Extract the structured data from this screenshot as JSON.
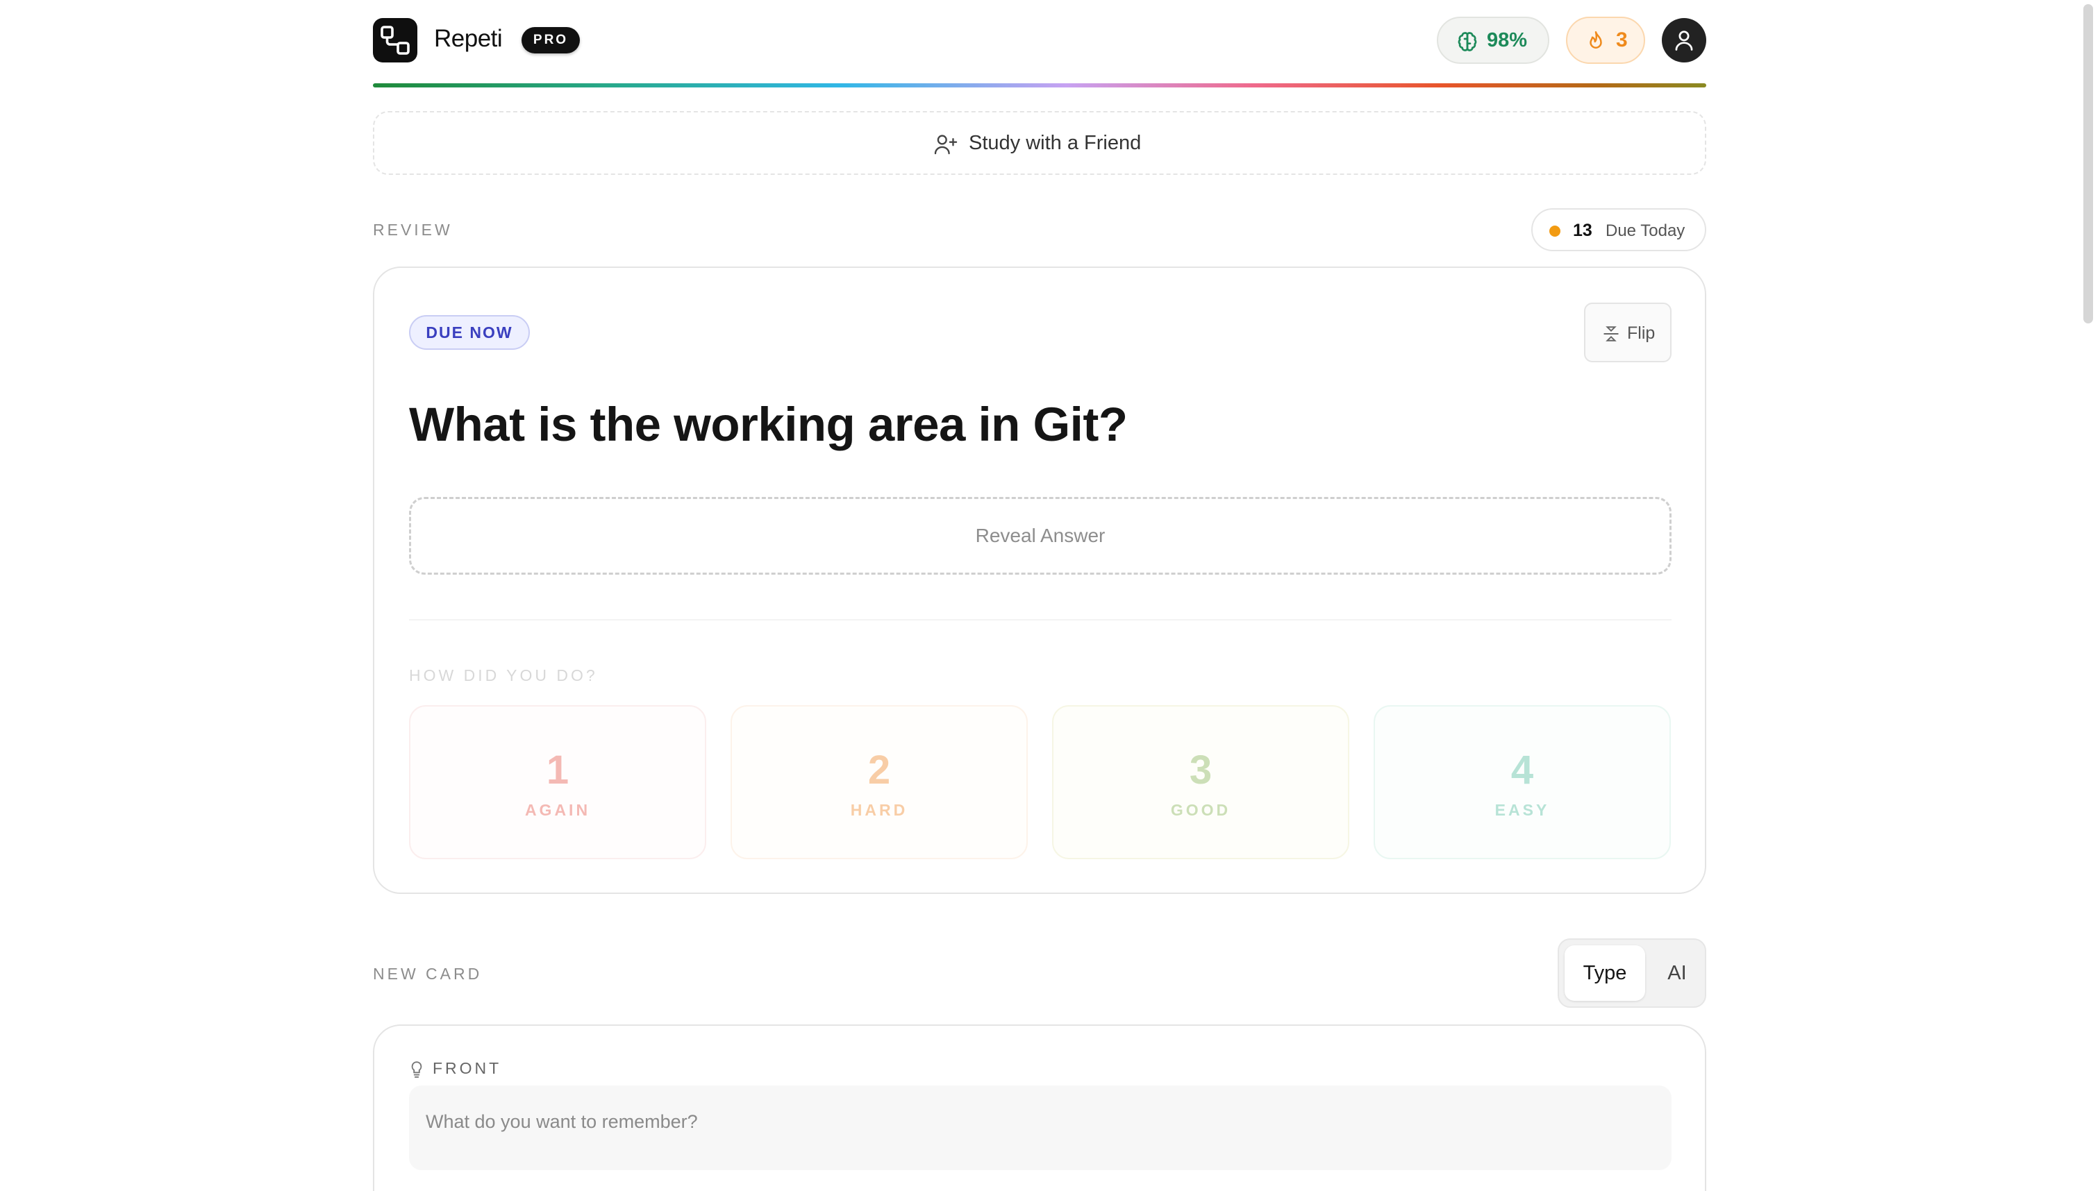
{
  "header": {
    "brand": "Repeti",
    "badge": "PRO",
    "retention": "98%",
    "streak": "3"
  },
  "friend_button": "Study with a Friend",
  "review": {
    "section_label": "REVIEW",
    "due_count": "13",
    "due_label": "Due Today",
    "status_badge": "DUE NOW",
    "flip_label": "Flip",
    "question": "What is the working area in Git?",
    "reveal_label": "Reveal Answer",
    "rating_prompt": "HOW DID YOU DO?",
    "ratings": [
      {
        "key": "1",
        "label": "AGAIN"
      },
      {
        "key": "2",
        "label": "HARD"
      },
      {
        "key": "3",
        "label": "GOOD"
      },
      {
        "key": "4",
        "label": "EASY"
      }
    ]
  },
  "new_card": {
    "section_label": "NEW CARD",
    "mode_type": "Type",
    "mode_ai": "AI",
    "front_label": "FRONT",
    "front_placeholder": "What do you want to remember?"
  },
  "colors": {
    "accent_green": "#1d8a5a",
    "streak_orange": "#ef8a1c",
    "due_dot": "#f29b12",
    "badge_indigo": "#3a3fbf"
  }
}
